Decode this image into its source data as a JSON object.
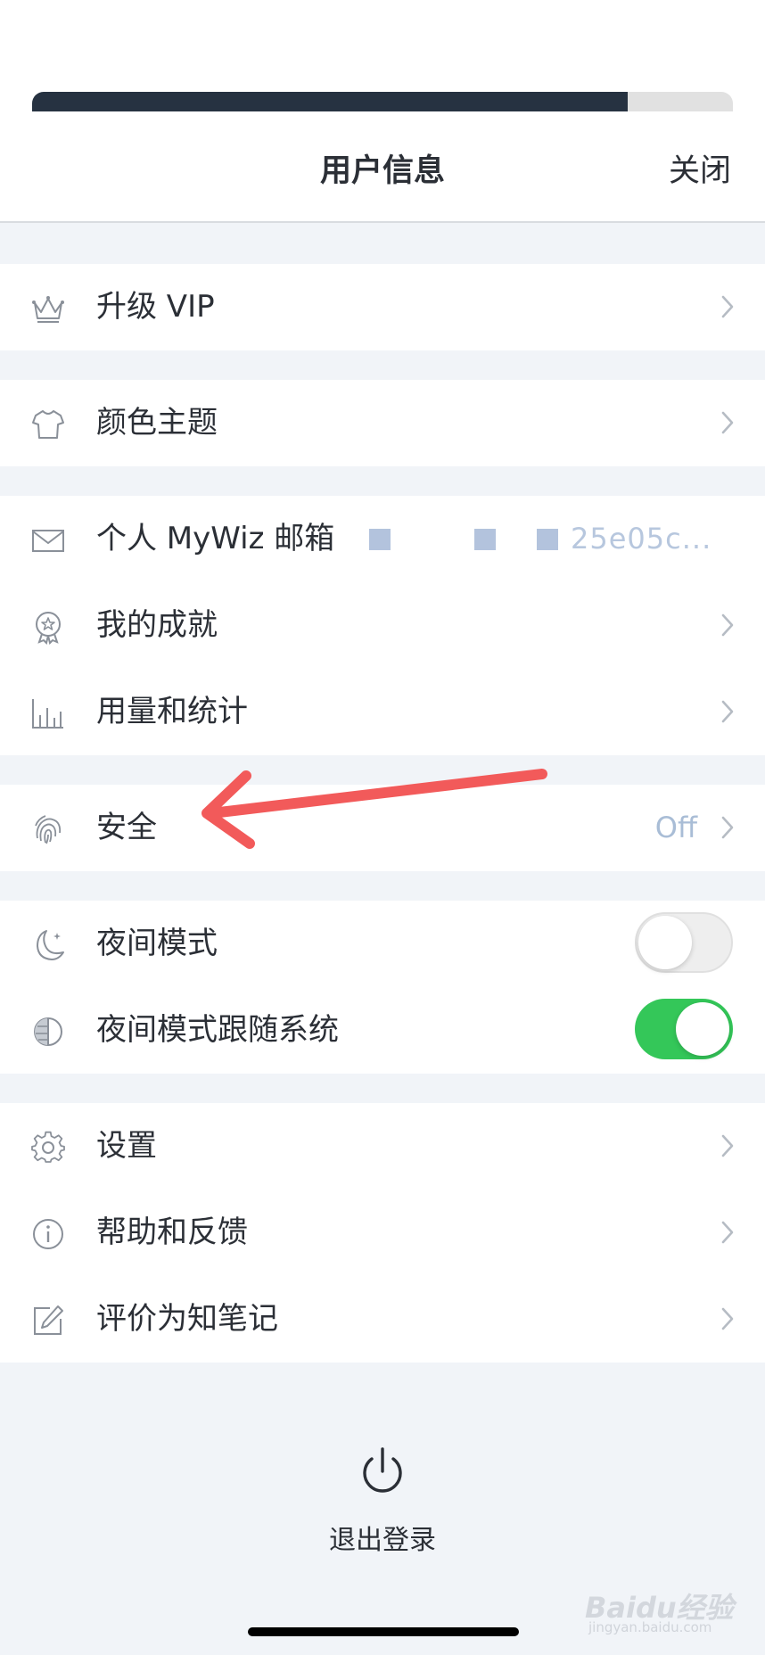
{
  "header": {
    "title": "用户信息",
    "close_label": "关闭",
    "progress_fraction": 0.85
  },
  "groups": {
    "vip": {
      "label": "升级 VIP"
    },
    "theme": {
      "label": "颜色主题"
    },
    "account": {
      "email_label": "个人 MyWiz 邮箱",
      "email_value_visible": "25e05c...",
      "achievements_label": "我的成就",
      "usage_label": "用量和统计"
    },
    "security": {
      "label": "安全",
      "value": "Off"
    },
    "night": {
      "night_mode_label": "夜间模式",
      "night_mode_on": false,
      "follow_system_label": "夜间模式跟随系统",
      "follow_system_on": true
    },
    "misc": {
      "settings_label": "设置",
      "help_label": "帮助和反馈",
      "rate_label": "评价为知笔记"
    }
  },
  "logout": {
    "label": "退出登录"
  },
  "watermark": {
    "text": "Baidu经验",
    "sub": "jingyan.baidu.com"
  },
  "colors": {
    "accent_progress": "#263241",
    "toggle_on": "#34c759",
    "annotation_arrow": "#f25a5a",
    "muted_value": "#a9bdd6"
  }
}
